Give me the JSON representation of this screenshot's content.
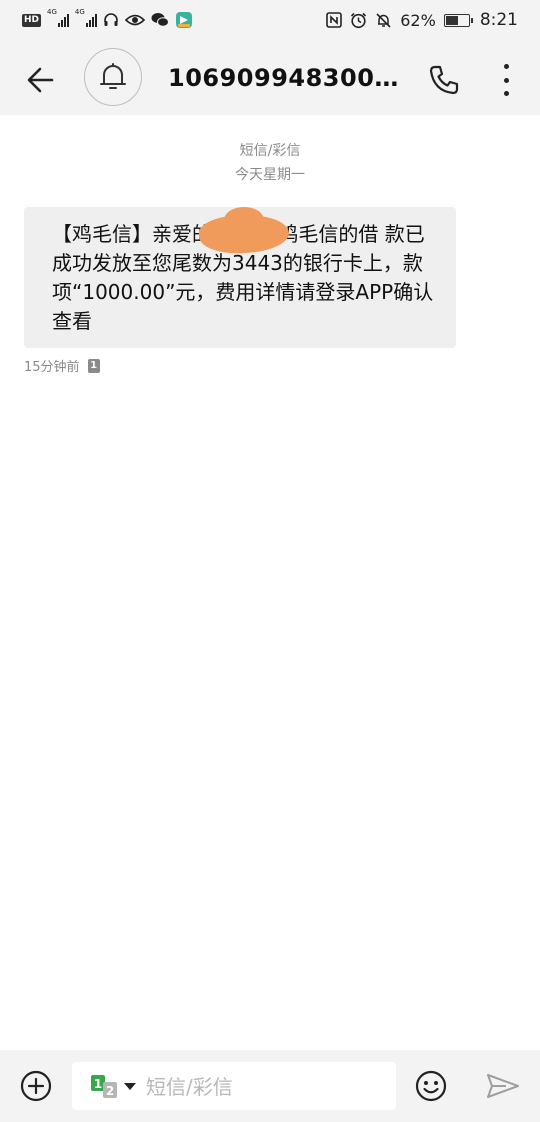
{
  "status_bar": {
    "hd": "HD",
    "net1": "4G",
    "net2": "4G",
    "battery_percent": "62%",
    "battery_level": 0.62,
    "time": "8:21",
    "icons": [
      "headphones-icon",
      "eye-icon",
      "wechat-icon",
      "app-icon",
      "nfc-icon",
      "alarm-icon",
      "mute-icon",
      "battery-icon"
    ]
  },
  "header": {
    "title": "10690994830030...",
    "icons": [
      "back-arrow-icon",
      "bell-icon",
      "phone-icon",
      "more-vertical-icon"
    ]
  },
  "conversation": {
    "channel_label": "短信/彩信",
    "date_label": "今天星期一",
    "messages": [
      {
        "text": "【鸡毛信】亲爱的          ，您在鸡毛信的借 款已成功发放至您尾数为3443的银行卡上，款项“1000.00”元，费用详情请登录APP确认查看",
        "time": "15分钟前",
        "sim": "1"
      }
    ]
  },
  "composer": {
    "placeholder": "短信/彩信",
    "value": "",
    "sim_primary": "1",
    "sim_secondary": "2",
    "icons": [
      "add-circle-icon",
      "sim-switch-icon",
      "emoji-icon",
      "send-icon"
    ]
  },
  "colors": {
    "bar_bg": "#f3f3f3",
    "bubble_bg": "#efefef",
    "meta_text": "#8a8a8a",
    "sim_green": "#35a84a",
    "redaction": "#f09a5c"
  }
}
